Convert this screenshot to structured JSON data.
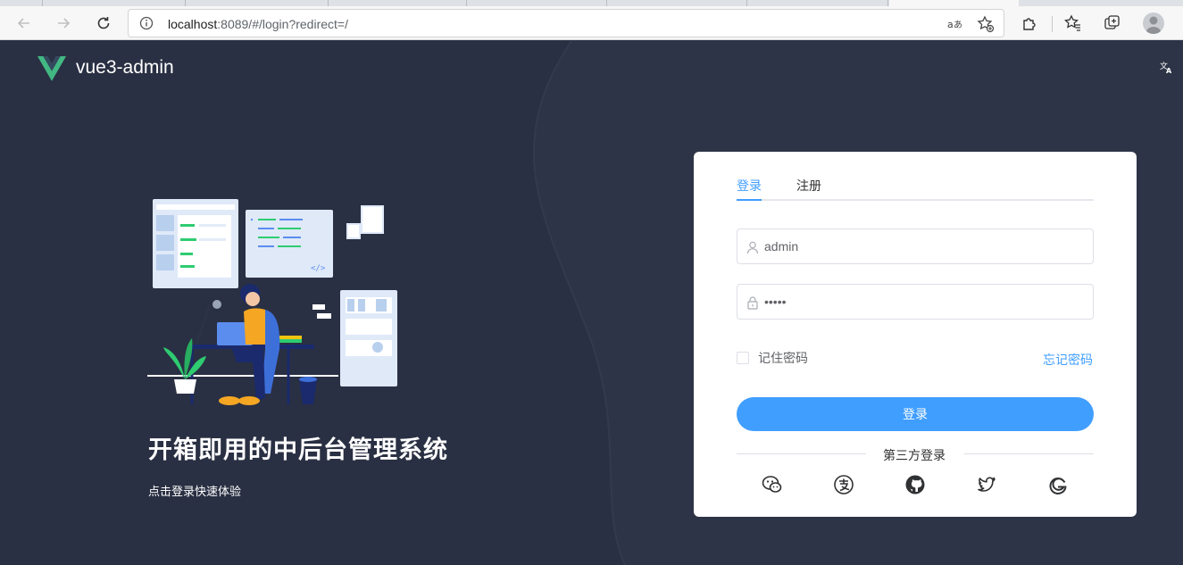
{
  "browser": {
    "url_host": "localhost",
    "url_path": ":8089/#/login?redirect=/"
  },
  "app": {
    "logo_text": "vue3-admin"
  },
  "hero": {
    "title": "开箱即用的中后台管理系统",
    "subtitle": "点击登录快速体验"
  },
  "login": {
    "tabs": [
      {
        "label": "登录",
        "active": true
      },
      {
        "label": "注册",
        "active": false
      }
    ],
    "username": "admin",
    "password": "•••••",
    "remember_label": "记住密码",
    "remember_checked": false,
    "forgot_label": "忘记密码",
    "submit_label": "登录",
    "third_party_label": "第三方登录",
    "social_icons": [
      "wechat-icon",
      "alipay-icon",
      "github-icon",
      "twitter-icon",
      "google-icon"
    ]
  },
  "colors": {
    "page_bg": "#2d3447",
    "accent": "#409eff",
    "vue_green": "#42b883"
  }
}
